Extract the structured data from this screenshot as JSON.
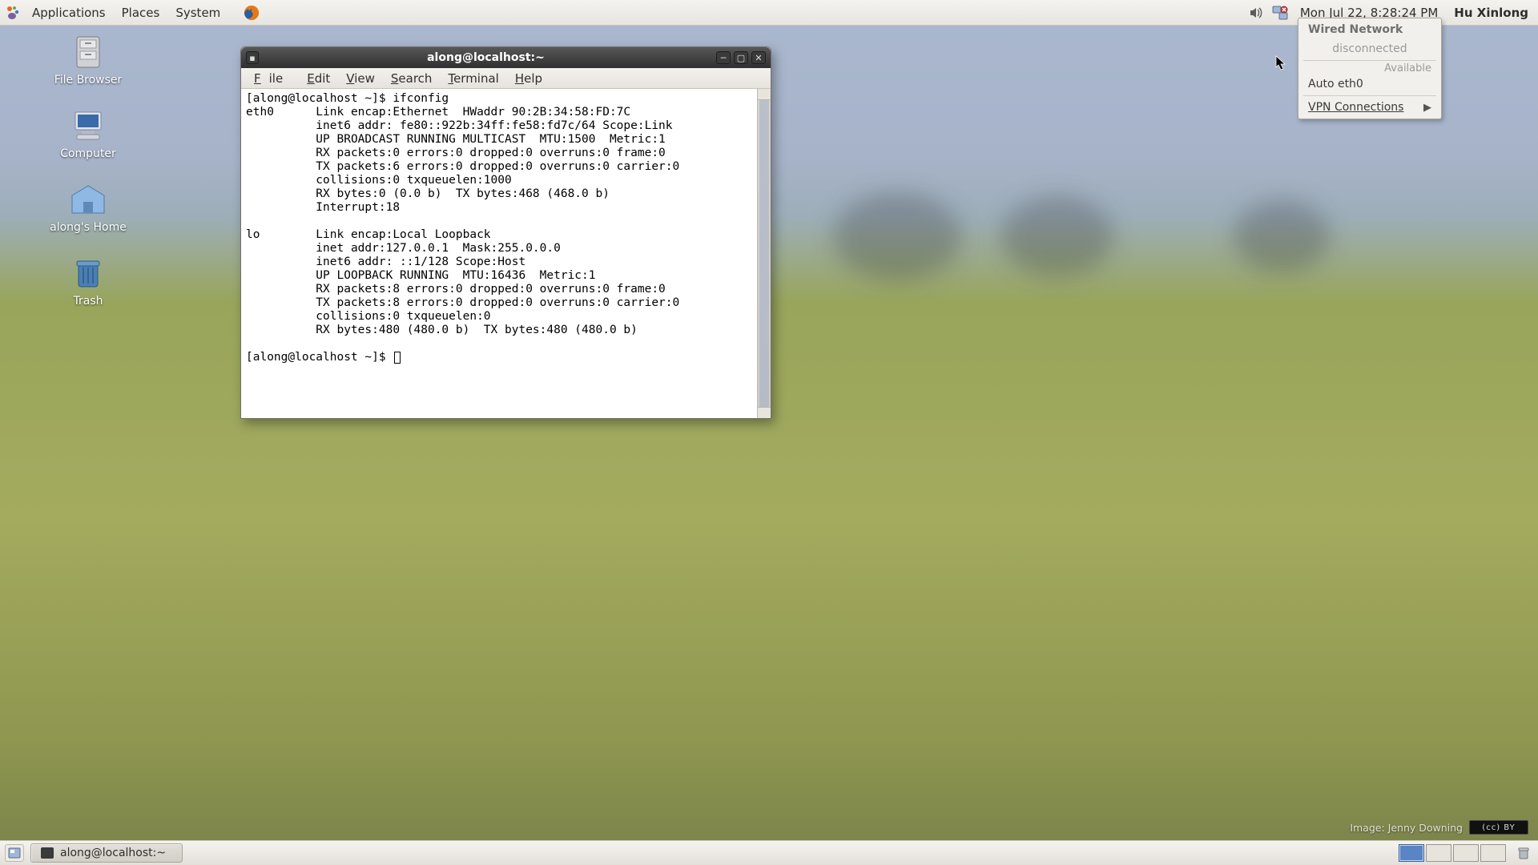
{
  "panel_top": {
    "menus": {
      "applications": "Applications",
      "places": "Places",
      "system": "System"
    },
    "clock": "Mon Jul 22,  8:28:24 PM",
    "username": "Hu Xinlong"
  },
  "desktop_icons": {
    "file_browser": "File Browser",
    "computer": "Computer",
    "home": "along's Home",
    "trash": "Trash"
  },
  "terminal": {
    "title": "along@localhost:~",
    "menus": {
      "file": "File",
      "edit": "Edit",
      "view": "View",
      "search": "Search",
      "terminal": "Terminal",
      "help": "Help"
    },
    "prompt1": "[along@localhost ~]$ ifconfig",
    "eth0": {
      "name": "eth0",
      "l1": "Link encap:Ethernet  HWaddr 90:2B:34:58:FD:7C",
      "l2": "inet6 addr: fe80::922b:34ff:fe58:fd7c/64 Scope:Link",
      "l3": "UP BROADCAST RUNNING MULTICAST  MTU:1500  Metric:1",
      "l4": "RX packets:0 errors:0 dropped:0 overruns:0 frame:0",
      "l5": "TX packets:6 errors:0 dropped:0 overruns:0 carrier:0",
      "l6": "collisions:0 txqueuelen:1000",
      "l7": "RX bytes:0 (0.0 b)  TX bytes:468 (468.0 b)",
      "l8": "Interrupt:18"
    },
    "lo": {
      "name": "lo",
      "l1": "Link encap:Local Loopback",
      "l2": "inet addr:127.0.0.1  Mask:255.0.0.0",
      "l3": "inet6 addr: ::1/128 Scope:Host",
      "l4": "UP LOOPBACK RUNNING  MTU:16436  Metric:1",
      "l5": "RX packets:8 errors:0 dropped:0 overruns:0 frame:0",
      "l6": "TX packets:8 errors:0 dropped:0 overruns:0 carrier:0",
      "l7": "collisions:0 txqueuelen:0",
      "l8": "RX bytes:480 (480.0 b)  TX bytes:480 (480.0 b)"
    },
    "prompt2": "[along@localhost ~]$ "
  },
  "network_menu": {
    "header": "Wired Network",
    "status": "disconnected",
    "available": "Available",
    "auto": "Auto eth0",
    "vpn": "VPN Connections"
  },
  "bottom_panel": {
    "task_label": "along@localhost:~"
  },
  "attribution": {
    "text": "Image: Jenny Downing",
    "cc": "(cc) BY"
  }
}
